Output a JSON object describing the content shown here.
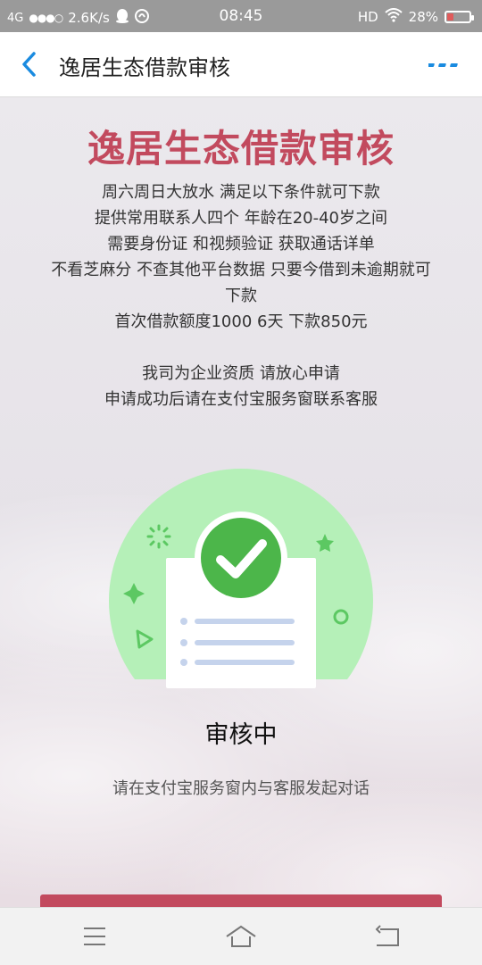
{
  "status_bar": {
    "network": "4G",
    "speed": "2.6K/s",
    "time": "08:45",
    "hd": "HD",
    "battery": "28%",
    "battery_level": 0.28
  },
  "nav": {
    "title": "逸居生态借款审核",
    "back_icon": "back-arrow-icon",
    "more_icon": "more-dots-icon"
  },
  "content": {
    "headline": "逸居生态借款审核",
    "description_lines": [
      "周六周日大放水 满足以下条件就可下款",
      "提供常用联系人四个  年龄在20-40岁之间",
      "需要身份证 和视频验证 获取通话详单",
      "不看芝麻分 不查其他平台数据 只要今借到未逾期就可",
      "下款",
      "首次借款额度1000  6天   下款850元"
    ],
    "notice_lines": [
      "我司为企业资质 请放心申请",
      "申请成功后请在支付宝服务窗联系客服"
    ],
    "status": "审核中",
    "hint": "请在支付宝服务窗内与客服发起对话"
  },
  "colors": {
    "accent": "#c24a5e",
    "nav_icon": "#1a8be0",
    "success_green": "#4cb64a",
    "success_bg": "#b5f0b8"
  },
  "bottom_nav": {
    "menu_icon": "menu-icon",
    "home_icon": "home-icon",
    "back_icon": "return-icon"
  }
}
